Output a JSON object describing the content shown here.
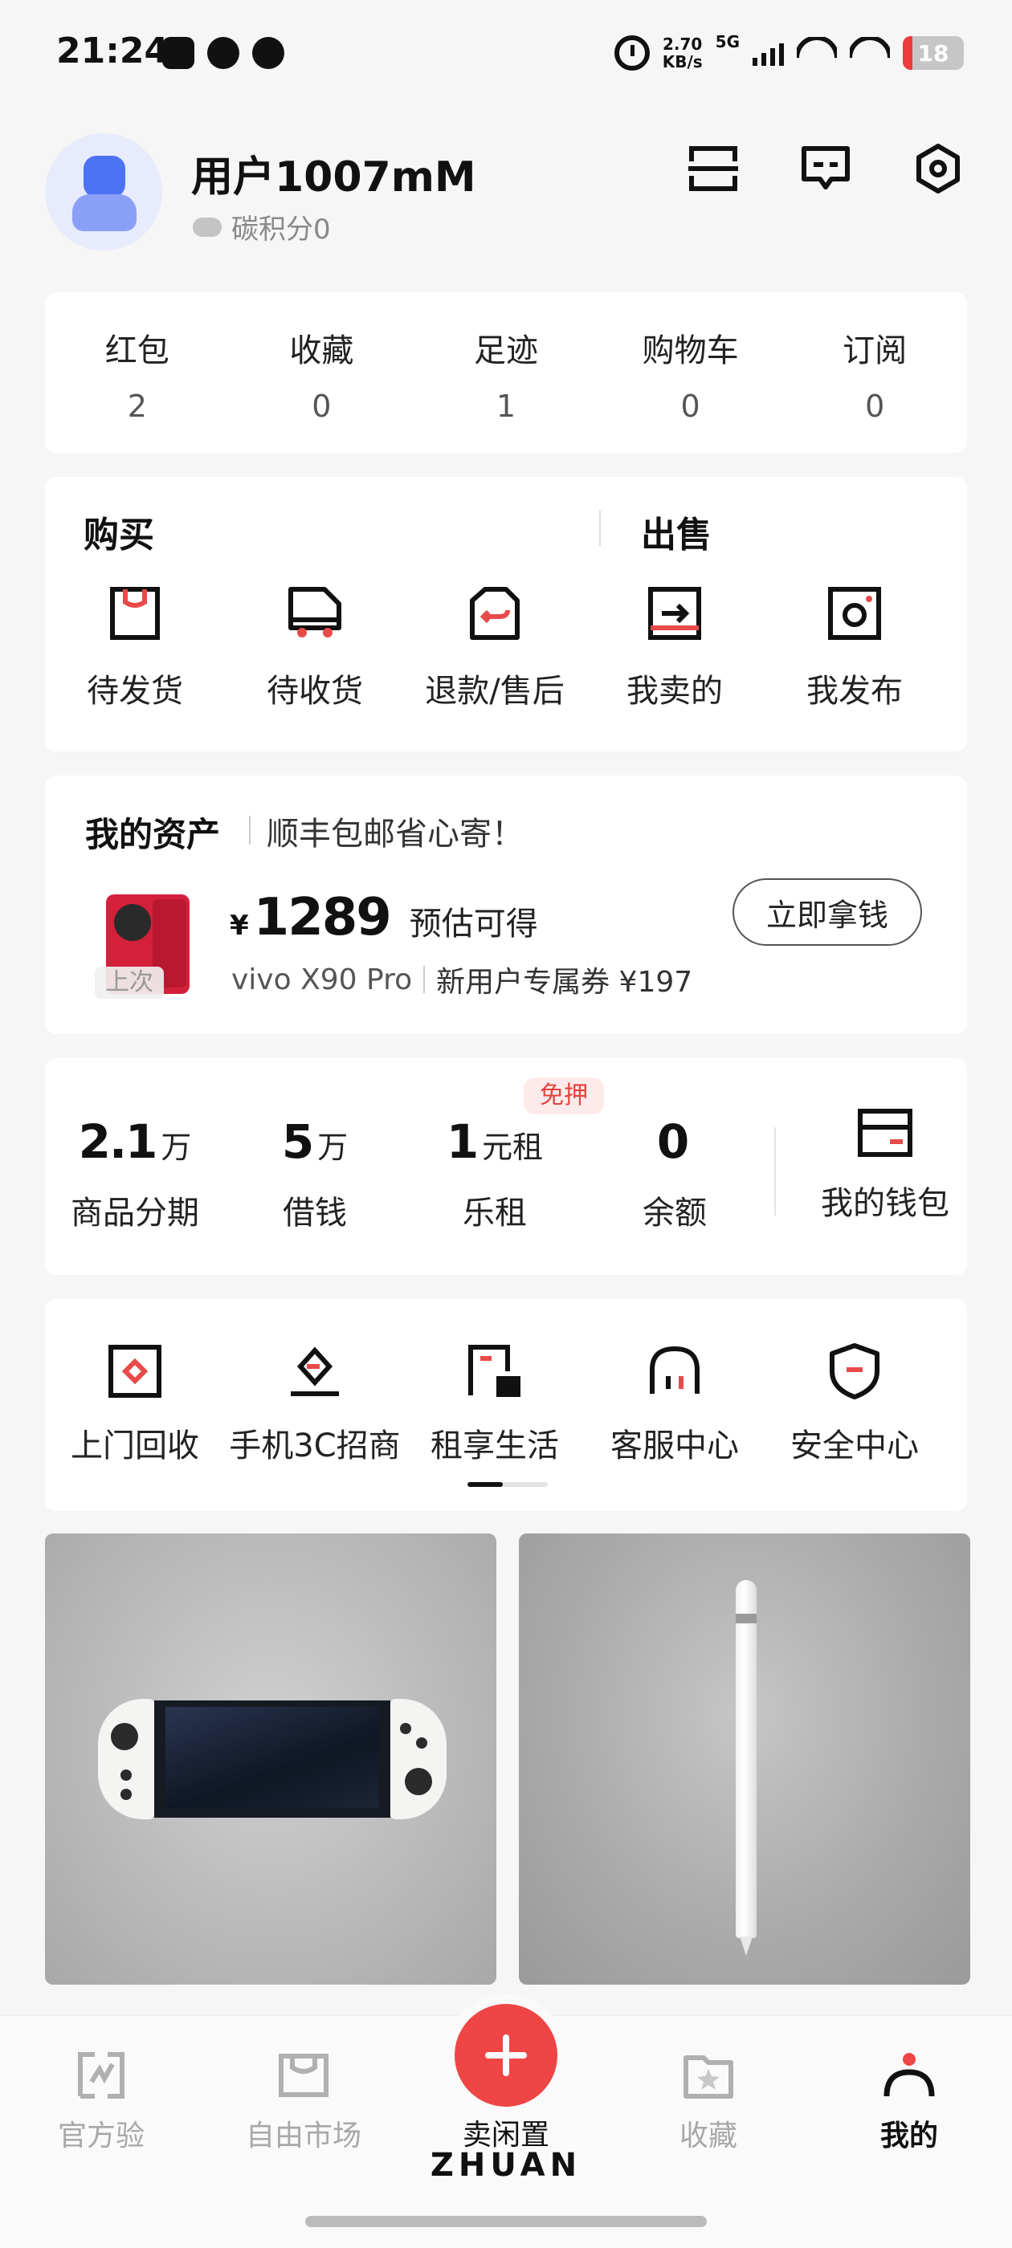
{
  "status_bar": {
    "time": "21:24",
    "net_speed": "2.70",
    "net_unit": "KB/s",
    "network": "5G",
    "battery": "18"
  },
  "profile": {
    "username": "用户1007mM",
    "carbon": "碳积分0",
    "carbon_icon": "co2-cloud-icon"
  },
  "header_icons": [
    "scan-icon",
    "message-icon",
    "settings-icon"
  ],
  "stats": [
    {
      "label": "红包",
      "value": "2"
    },
    {
      "label": "收藏",
      "value": "0"
    },
    {
      "label": "足迹",
      "value": "1"
    },
    {
      "label": "购物车",
      "value": "0"
    },
    {
      "label": "订阅",
      "value": "0"
    }
  ],
  "orders": {
    "buy_title": "购买",
    "sell_title": "出售",
    "items": [
      {
        "label": "待发货",
        "icon": "box-icon"
      },
      {
        "label": "待收货",
        "icon": "truck-icon"
      },
      {
        "label": "退款/售后",
        "icon": "return-icon"
      },
      {
        "label": "我卖的",
        "icon": "sold-icon"
      },
      {
        "label": "我发布",
        "icon": "publish-icon"
      }
    ]
  },
  "assets": {
    "title": "我的资产",
    "subtitle": "顺丰包邮省心寄！",
    "last_tag": "上次",
    "currency": "¥",
    "price": "1289",
    "price_note": "预估可得",
    "model": "vivo X90 Pro",
    "promo": "新用户专属券 ¥197",
    "cta": "立即拿钱"
  },
  "finance": {
    "items": [
      {
        "num": "2.1",
        "unit": "万",
        "label": "商品分期"
      },
      {
        "num": "5",
        "unit": "万",
        "label": "借钱"
      },
      {
        "num": "1",
        "unit": "元租",
        "label": "乐租"
      },
      {
        "num": "0",
        "unit": "",
        "label": "余额"
      }
    ],
    "badge": "免押",
    "wallet": "我的钱包"
  },
  "services": [
    {
      "label": "上门回收",
      "icon": "recycle-icon"
    },
    {
      "label": "手机3C招商",
      "icon": "merchant-icon"
    },
    {
      "label": "租享生活",
      "icon": "rent-icon"
    },
    {
      "label": "客服中心",
      "icon": "headset-icon"
    },
    {
      "label": "安全中心",
      "icon": "shield-icon"
    }
  ],
  "bottom_nav": {
    "items": [
      {
        "label": "官方验",
        "icon": "verify-icon"
      },
      {
        "label": "自由市场",
        "icon": "market-icon"
      },
      {
        "label": "卖闲置",
        "icon": "plus-icon"
      },
      {
        "label": "收藏",
        "icon": "favorite-icon"
      },
      {
        "label": "我的",
        "icon": "profile-icon"
      }
    ],
    "brand": "ZHUAN"
  },
  "colors": {
    "accent": "#ef4545",
    "avatar_bg": "#e8ebfb",
    "avatar_fg": "#4b73f3"
  }
}
